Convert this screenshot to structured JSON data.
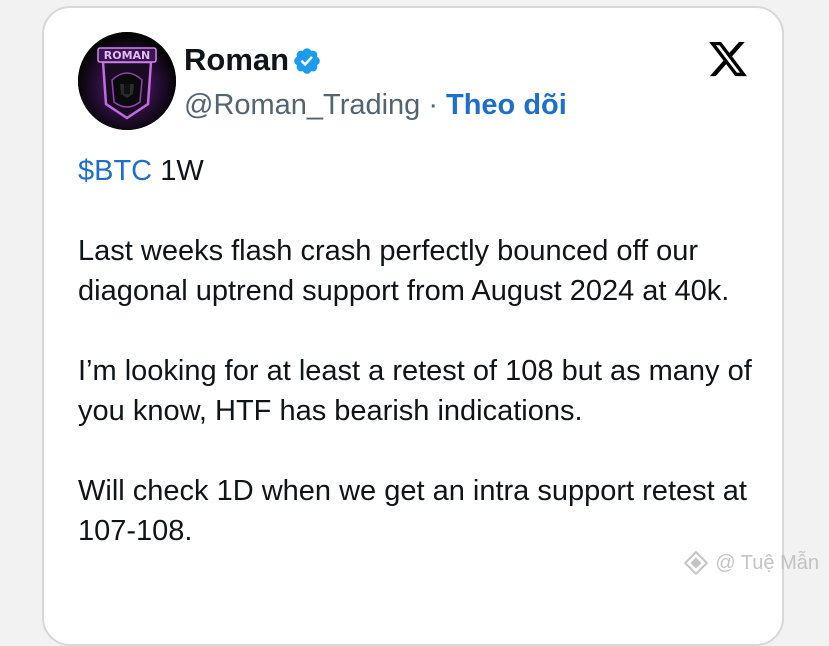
{
  "tweet": {
    "author": {
      "display_name": "Roman",
      "handle": "@Roman_Trading",
      "separator": "·",
      "follow_label": "Theo dõi",
      "avatar_logo_text": "ROMAN"
    },
    "cashtag": "$BTC",
    "timeframe": " 1W",
    "paragraphs": [
      "Last weeks flash crash perfectly bounced off our diagonal uptrend support from August 2024 at 40k.",
      "I’m looking for at least a retest of 108 but as many of you know, HTF has bearish indications.",
      "Will check 1D when we get an intra support retest at 107-108."
    ]
  },
  "icons": {
    "verified": "verified-badge-icon",
    "platform": "x-logo-icon",
    "watermark": "diamond-logo-icon"
  },
  "watermark": {
    "text": "@ Tuệ Mẫn"
  },
  "colors": {
    "link": "#1d6fc7",
    "verified": "#1d9bf0",
    "text": "#0f1419",
    "muted": "#536471"
  }
}
